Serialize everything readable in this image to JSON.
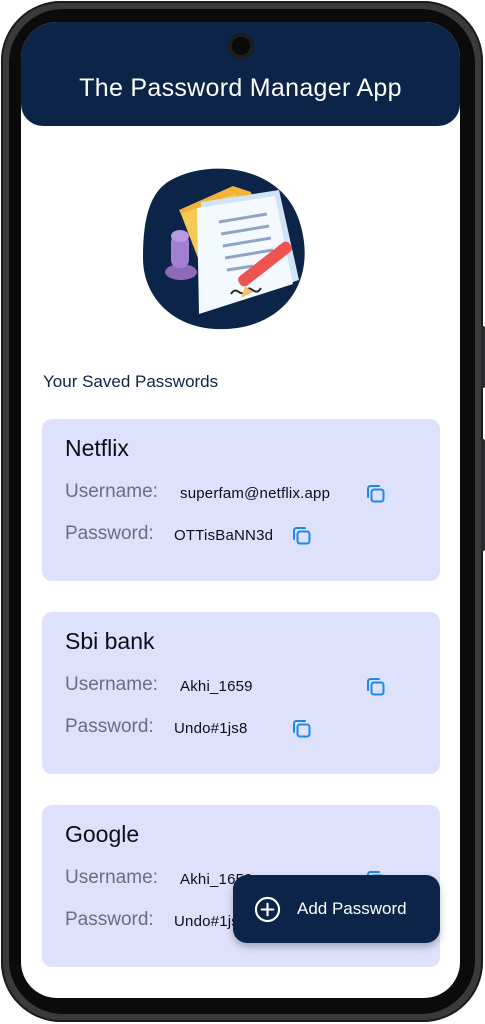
{
  "app": {
    "title": "The Password Manager App",
    "accent_color": "#0b2447",
    "card_color": "#dde1fb",
    "copy_icon_color": "#1e88e5"
  },
  "section": {
    "title": "Your Saved Passwords"
  },
  "cards": [
    {
      "name": "Netflix",
      "username_label": "Username:",
      "username": "superfam@netflix.app",
      "password_label": "Password:",
      "password": "OTTisBaNN3d",
      "copy_icon": "copy-icon"
    },
    {
      "name": "Sbi bank",
      "username_label": "Username:",
      "username": "Akhi_1659",
      "password_label": "Password:",
      "password": "Undo#1js8",
      "copy_icon": "copy-icon"
    },
    {
      "name": "Google",
      "username_label": "Username:",
      "username": "Akhi_1659",
      "password_label": "Password:",
      "password": "Undo#1js8",
      "copy_icon": "copy-icon"
    }
  ],
  "fab": {
    "label": "Add Password",
    "icon": "add-circle-icon"
  }
}
